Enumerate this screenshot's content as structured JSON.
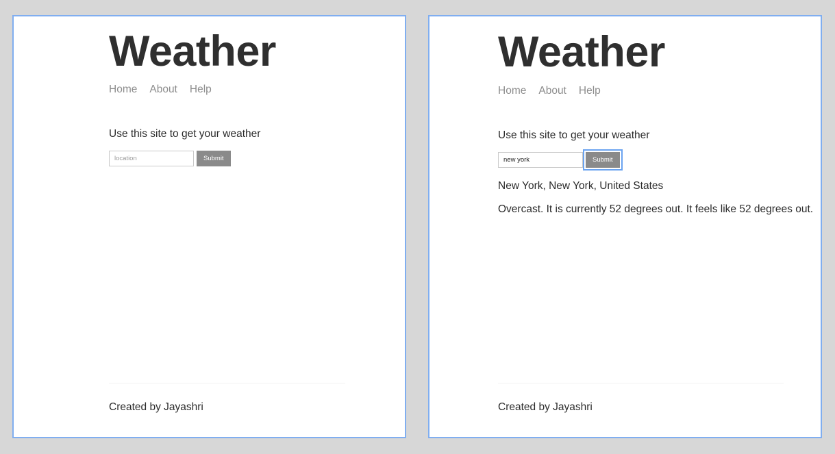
{
  "page_background": "#d7d7d7",
  "panel": {
    "background": "#ffffff",
    "border_color": "#80aef0"
  },
  "theme": {
    "heading_color": "#2f2f2f",
    "nav_link_color": "#8d8d8d",
    "body_text_color": "#2b2b2b",
    "button_background": "#8a8a8a",
    "button_text_color": "#ffffff",
    "focus_ring_color": "#6aa3f0",
    "input_border_color": "#c8c8c8",
    "placeholder_color": "#9a9a9a",
    "footer_rule_color": "#f2f2f2"
  },
  "site": {
    "title": "Weather",
    "nav": [
      {
        "label": "Home"
      },
      {
        "label": "About"
      },
      {
        "label": "Help"
      }
    ],
    "intro": "Use this site to get your weather",
    "input_placeholder": "location",
    "submit_label": "Submit",
    "footer_text": "Created by Jayashri"
  },
  "panels": {
    "left": {
      "input_value": "",
      "submit_focused": false,
      "results": []
    },
    "right": {
      "input_value": "new york",
      "submit_focused": true,
      "results": [
        "New York, New York, United States",
        "Overcast. It is currently 52 degrees out. It feels like 52 degrees out."
      ]
    }
  }
}
